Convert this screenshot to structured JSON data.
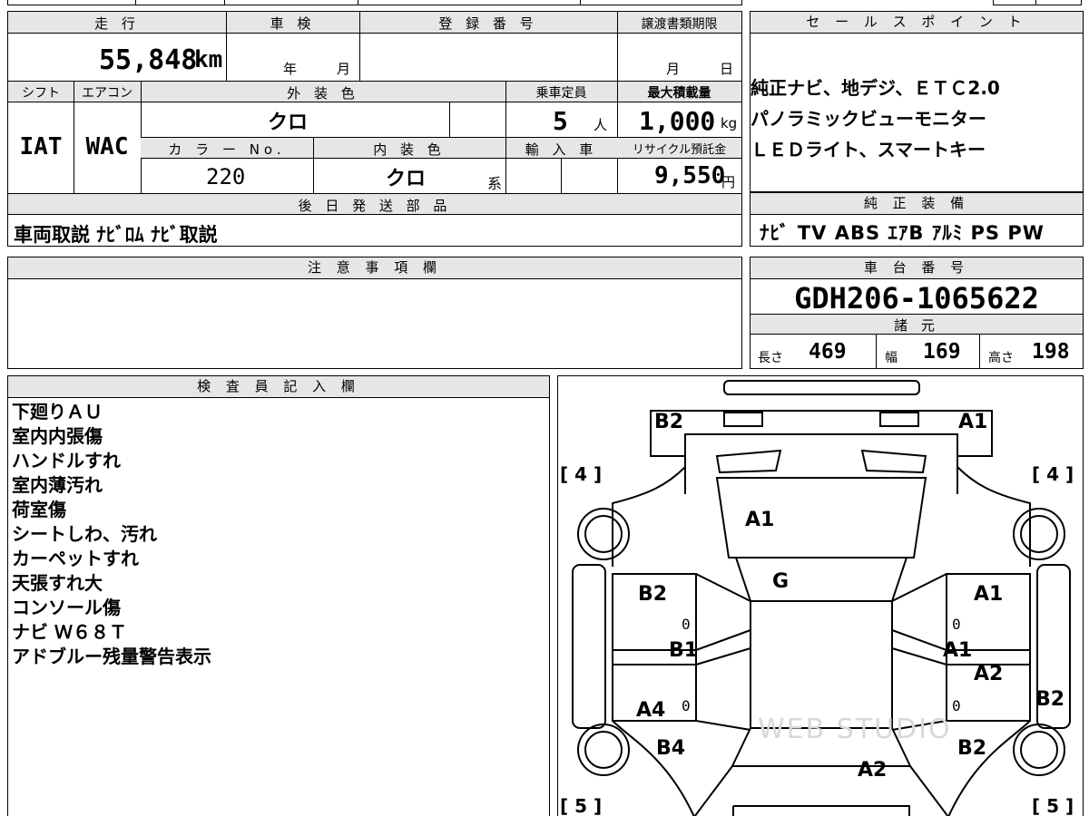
{
  "vehicle": {
    "mileage_label": "走 行",
    "mileage_value": "55,848",
    "mileage_unit": "km",
    "inspection_label": "車 検",
    "inspection_year": "年",
    "inspection_month": "月",
    "registration_label": "登 録 番 号",
    "transfer_label": "譲渡書類期限",
    "transfer_month": "月",
    "transfer_day": "日",
    "shift_label": "シフト",
    "aircon_label": "エアコン",
    "exterior_label": "外 装 色",
    "capacity_label": "乗車定員",
    "load_label": "最大積載量",
    "shift_value": "IAT",
    "aircon_value": "WAC",
    "exterior_value": "クロ",
    "capacity_value": "5",
    "capacity_unit": "人",
    "load_value": "1,000",
    "load_unit": "kg",
    "color_no_label": "カ ラ ー No.",
    "interior_label": "内 装 色",
    "import_label": "輸 入 車",
    "recycle_label": "リサイクル預託金",
    "color_no_value": "220",
    "interior_value": "クロ",
    "interior_suffix": "系",
    "recycle_value": "9,550",
    "recycle_unit": "円",
    "later_parts_label": "後 日 発 送 部 品",
    "later_parts_value": "車両取説 ﾅﾋﾞﾛﾑ ﾅﾋﾞ取説",
    "notes_label": "注 意 事 項 欄"
  },
  "sales": {
    "label": "セ ー ル ス ポ イ ン ト",
    "lines": [
      "純正ナビ、地デジ、ＥＴＣ2.0",
      "パノラミックビューモニター",
      "ＬＥＤライト、スマートキー"
    ]
  },
  "equipment": {
    "label": "純 正 装 備",
    "value": "ﾅﾋﾞ TV ABS ｴｱB ｱﾙﾐ PS PW"
  },
  "chassis": {
    "label": "車 台 番 号",
    "value": "GDH206-1065622",
    "spec_label": "諸 元",
    "length_label": "長さ",
    "length_value": "469",
    "width_label": "幅",
    "width_value": "169",
    "height_label": "高さ",
    "height_value": "198"
  },
  "inspector": {
    "label": "検 査 員 記 入 欄",
    "lines": [
      "下廻りＡＵ",
      "室内内張傷",
      "ハンドルすれ",
      "室内薄汚れ",
      "荷室傷",
      "シートしわ、汚れ",
      "カーペットすれ",
      "天張すれ大",
      "コンソール傷",
      "ナビ Ｗ６８Ｔ",
      "アドブルー残量警告表示"
    ]
  },
  "diagram": {
    "marks": {
      "rear_left": "B2",
      "rear_right": "A1",
      "rear_glass": "A1",
      "roof": "G",
      "left_upper": "B2",
      "left_mid": "B1",
      "left_lower": "A4",
      "left_front": "B4",
      "right_upper": "A1",
      "right_mid": "A1",
      "right_mid2": "A2",
      "right_step": "B2",
      "right_front": "B2",
      "hood": "A2"
    },
    "tire_rear_left": "[ 4 ]",
    "tire_rear_right": "[ 4 ]",
    "tire_front_left": "[ 5 ]",
    "tire_front_right": "[ 5 ]",
    "zeros": [
      "0",
      "0",
      "0",
      "0"
    ],
    "watermark": "WEB STUDIO"
  }
}
